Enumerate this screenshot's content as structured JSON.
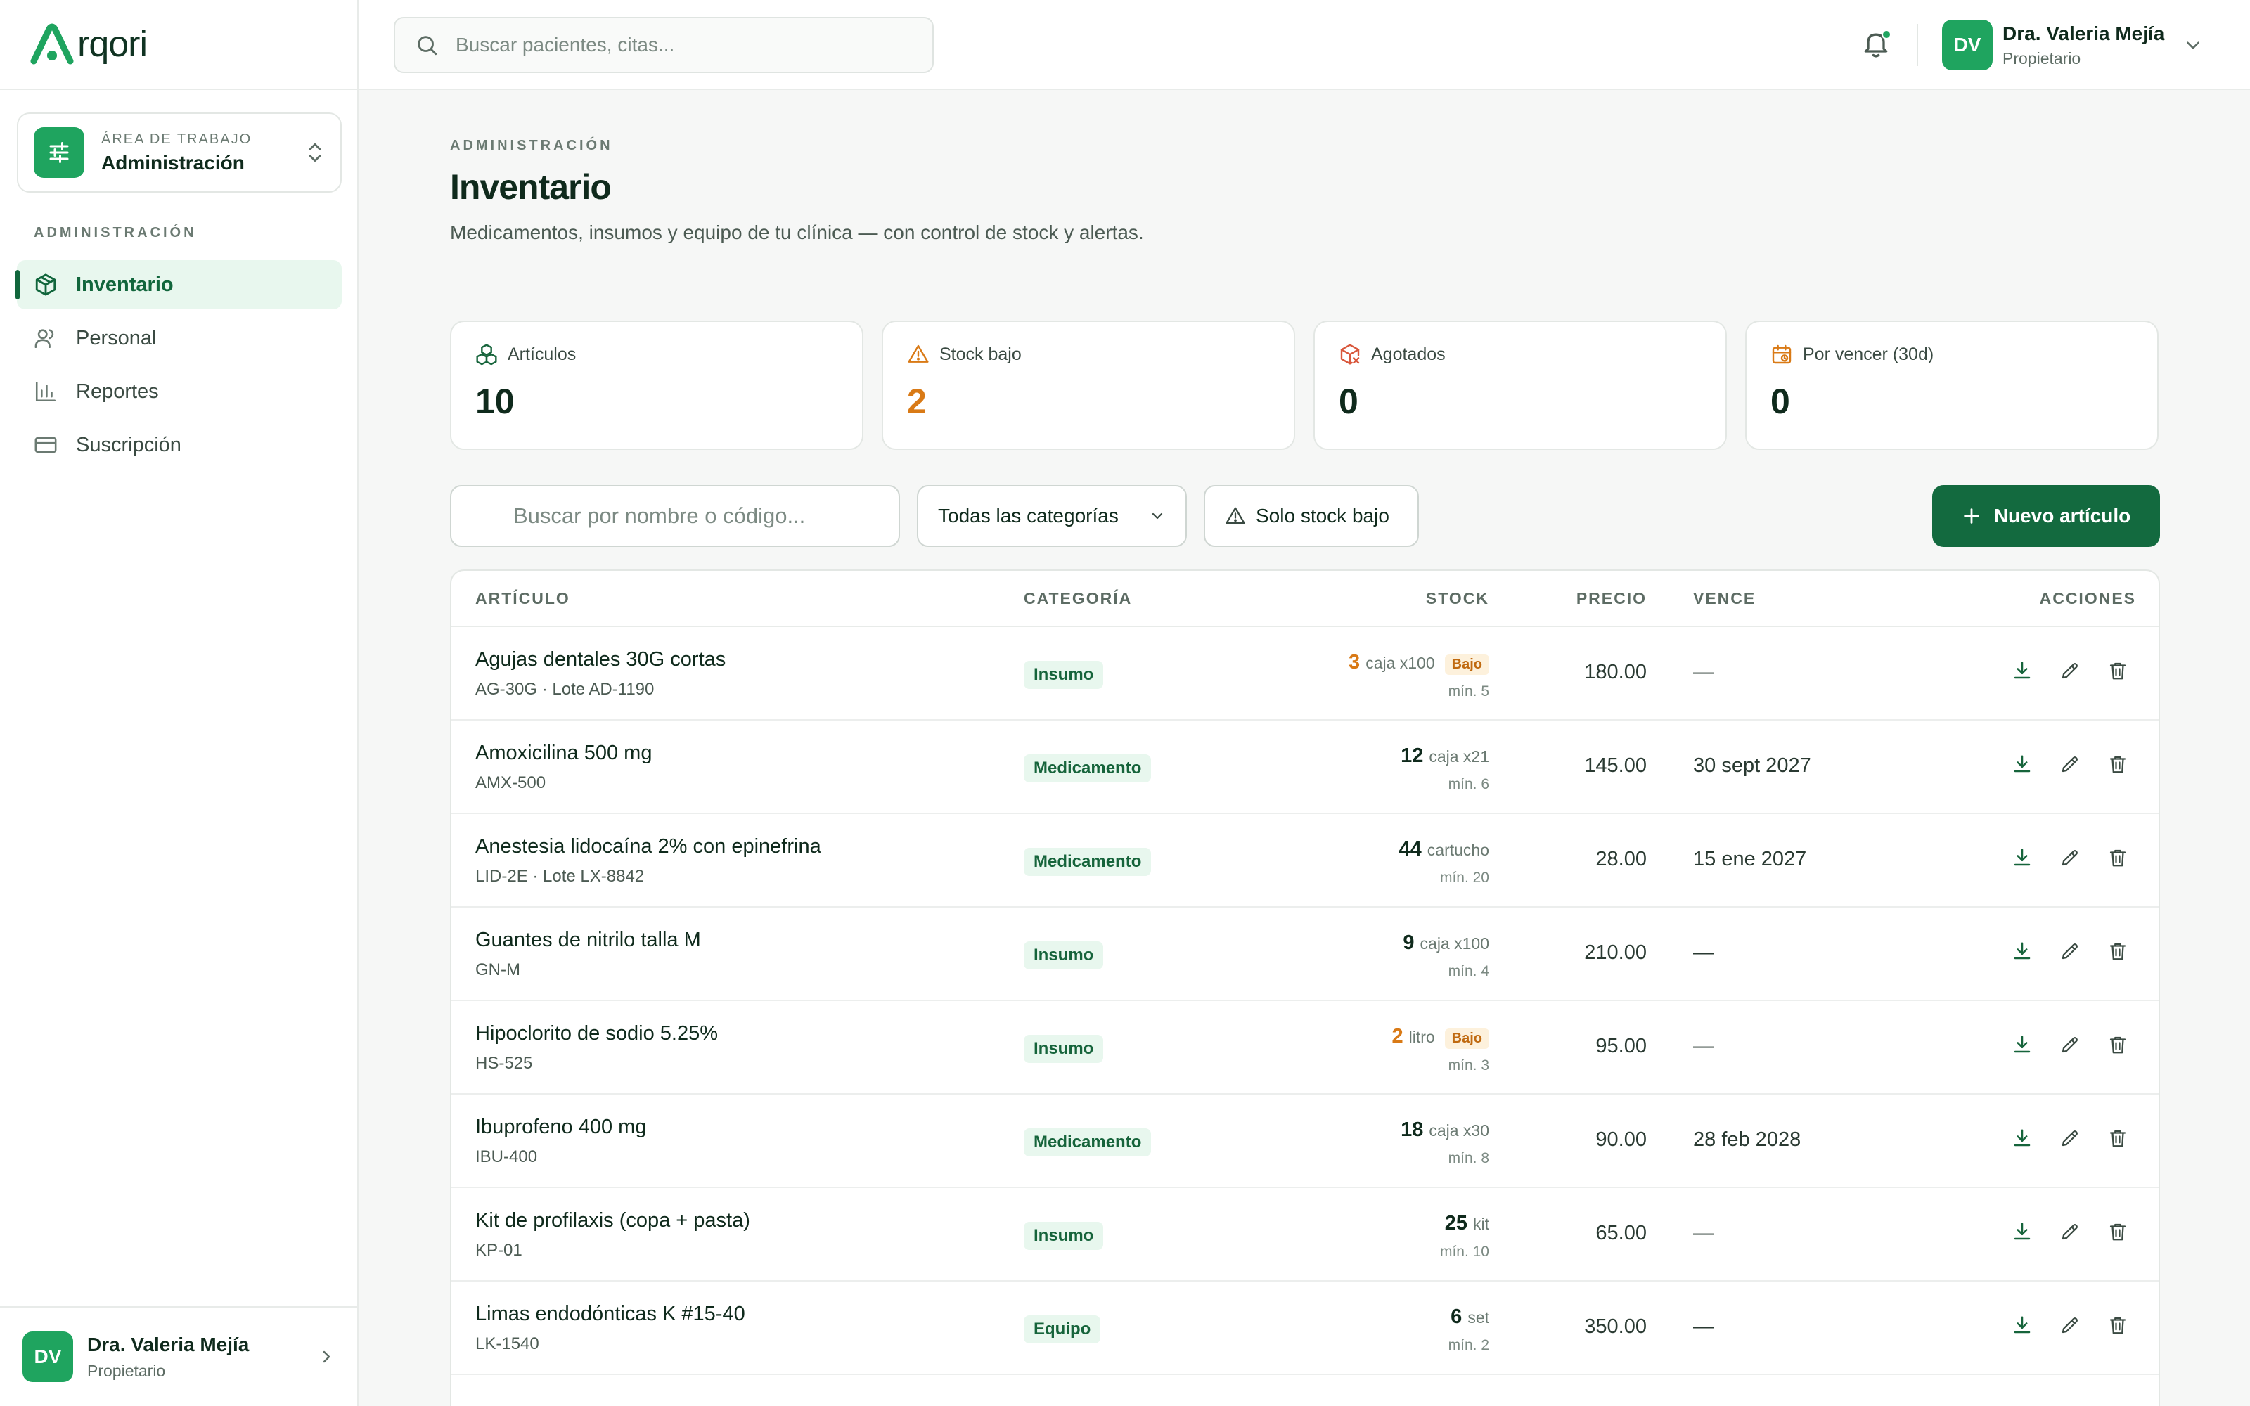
{
  "app": {
    "brand": "rqori"
  },
  "workspace": {
    "caption": "ÁREA DE TRABAJO",
    "name": "Administración"
  },
  "nav": {
    "section": "ADMINISTRACIÓN",
    "items": [
      {
        "label": "Inventario",
        "icon": "box-icon",
        "active": true
      },
      {
        "label": "Personal",
        "icon": "users-icon"
      },
      {
        "label": "Reportes",
        "icon": "bar-chart-icon"
      },
      {
        "label": "Suscripción",
        "icon": "credit-card-icon"
      }
    ]
  },
  "header": {
    "search_placeholder": "Buscar pacientes, citas...",
    "user": {
      "initials": "DV",
      "name": "Dra. Valeria Mejía",
      "role": "Propietario"
    }
  },
  "page": {
    "eyebrow": "ADMINISTRACIÓN",
    "title": "Inventario",
    "subtitle": "Medicamentos, insumos y equipo de tu clínica — con control de stock y alertas."
  },
  "stats": [
    {
      "label": "Artículos",
      "value": "10"
    },
    {
      "label": "Stock bajo",
      "value": "2"
    },
    {
      "label": "Agotados",
      "value": "0"
    },
    {
      "label": "Por vencer (30d)",
      "value": "0"
    }
  ],
  "filters": {
    "search_placeholder": "Buscar por nombre o código...",
    "category": "Todas las categorías",
    "low_stock": "Solo stock bajo",
    "new_button": "Nuevo artículo"
  },
  "table": {
    "headers": {
      "item": "ARTÍCULO",
      "category": "CATEGORÍA",
      "stock": "STOCK",
      "price": "PRECIO",
      "expires": "VENCE",
      "actions": "ACCIONES"
    },
    "low_label": "Bajo",
    "rows": [
      {
        "name": "Agujas dentales 30G cortas",
        "code": "AG-30G · Lote AD-1190",
        "category": "Insumo",
        "qty": "3",
        "unit": "caja x100",
        "min": "mín. 5",
        "price": "180.00",
        "expires": "—",
        "low": true
      },
      {
        "name": "Amoxicilina 500 mg",
        "code": "AMX-500",
        "category": "Medicamento",
        "qty": "12",
        "unit": "caja x21",
        "min": "mín. 6",
        "price": "145.00",
        "expires": "30 sept 2027",
        "low": false
      },
      {
        "name": "Anestesia lidocaína 2% con epinefrina",
        "code": "LID-2E · Lote LX-8842",
        "category": "Medicamento",
        "qty": "44",
        "unit": "cartucho",
        "min": "mín. 20",
        "price": "28.00",
        "expires": "15 ene 2027",
        "low": false
      },
      {
        "name": "Guantes de nitrilo talla M",
        "code": "GN-M",
        "category": "Insumo",
        "qty": "9",
        "unit": "caja x100",
        "min": "mín. 4",
        "price": "210.00",
        "expires": "—",
        "low": false
      },
      {
        "name": "Hipoclorito de sodio 5.25%",
        "code": "HS-525",
        "category": "Insumo",
        "qty": "2",
        "unit": "litro",
        "min": "mín. 3",
        "price": "95.00",
        "expires": "—",
        "low": true
      },
      {
        "name": "Ibuprofeno 400 mg",
        "code": "IBU-400",
        "category": "Medicamento",
        "qty": "18",
        "unit": "caja x30",
        "min": "mín. 8",
        "price": "90.00",
        "expires": "28 feb 2028",
        "low": false
      },
      {
        "name": "Kit de profilaxis (copa + pasta)",
        "code": "KP-01",
        "category": "Insumo",
        "qty": "25",
        "unit": "kit",
        "min": "mín. 10",
        "price": "65.00",
        "expires": "—",
        "low": false
      },
      {
        "name": "Limas endodónticas K #15-40",
        "code": "LK-1540",
        "category": "Equipo",
        "qty": "6",
        "unit": "set",
        "min": "mín. 2",
        "price": "350.00",
        "expires": "—",
        "low": false
      }
    ]
  },
  "colors": {
    "brand": "#1fa45f",
    "primary_button": "#136a3f",
    "warning": "#d97a16"
  }
}
